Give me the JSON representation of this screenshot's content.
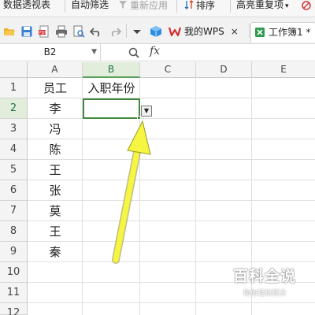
{
  "ribbon": {
    "pivot_table": "数据透视表",
    "auto_filter": "自动筛选",
    "reapply": "重新应用",
    "sort": "排序",
    "highlight_dup": "高亮重复项",
    "more": "▾"
  },
  "quickbar": {
    "tabs": [
      {
        "label": "我的WPS",
        "close": "×"
      },
      {
        "label": "工作簿1 *"
      }
    ]
  },
  "formula_bar": {
    "name_box": "B2",
    "name_arrow": "▼",
    "fx": "fx"
  },
  "sheet": {
    "columns": [
      "A",
      "B",
      "C",
      "D",
      "E"
    ],
    "rows": [
      "1",
      "2",
      "3",
      "4",
      "5",
      "6",
      "7",
      "8",
      "9",
      "10",
      "11",
      "12"
    ],
    "cells": {
      "A1": "员工",
      "B1": "入职年份",
      "A2": "李",
      "A3": "冯",
      "A4": "陈",
      "A5": "王",
      "A6": "张",
      "A7": "莫",
      "A8": "王",
      "A9": "秦"
    },
    "active_cell": "B2",
    "dropdown_arrow": "▼"
  },
  "watermark": {
    "title": "百科全说",
    "subtitle": "助你轻松解决"
  },
  "colors": {
    "annotation_arrow": "#f5f542",
    "selection": "#3f8a3f"
  }
}
